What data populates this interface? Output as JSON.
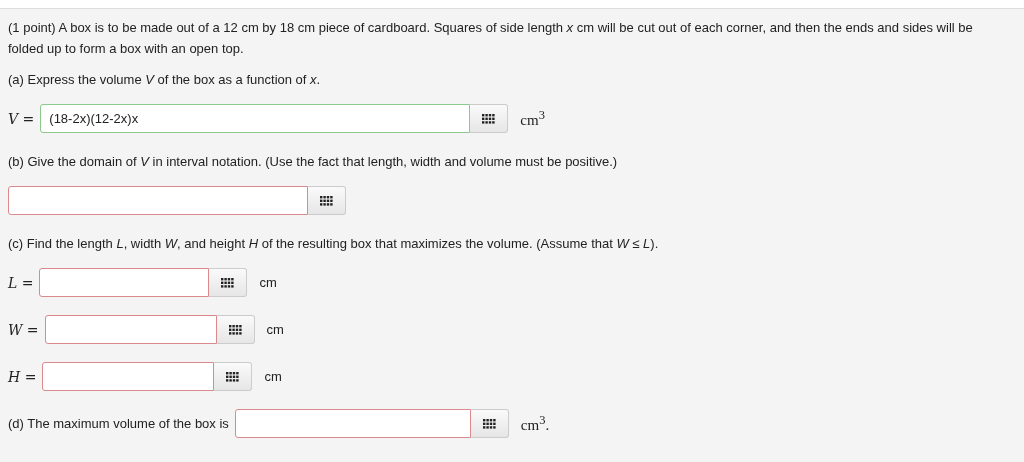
{
  "intro": "(1 point) A box is to be made out of a 12 cm by 18 cm piece of cardboard. Squares of side length *x* cm will be cut out of each corner, and then the ends and sides will be folded up to form a box with an open top.",
  "parts": [
    {
      "kind": "question",
      "text": "(a) Express the volume *V* of the box as a function of *x*."
    },
    {
      "kind": "answer",
      "label": "*V* =",
      "value": "(18-2x)(12-2x)x",
      "correct": true,
      "unit": "cm$^{3}$",
      "unit_math": true
    },
    {
      "kind": "question",
      "text": "(b) Give the domain of *V* in interval notation. (Use the fact that length, width and volume must be positive.)"
    },
    {
      "kind": "answer",
      "correct": false
    },
    {
      "kind": "question",
      "text": "(c) Find the length *L*, width *W*, and height *H* of the resulting box that maximizes the volume. (Assume that *W* ≤ *L*)."
    },
    {
      "kind": "answer",
      "label": "*L* =",
      "correct": false,
      "unit": "cm",
      "unit_math": false
    },
    {
      "kind": "answer",
      "label": "*W* =",
      "correct": false,
      "unit": "cm",
      "unit_math": false
    },
    {
      "kind": "answer",
      "label": "*H* =",
      "correct": false,
      "unit": "cm",
      "unit_math": false
    },
    {
      "kind": "answer",
      "prompt": "(d) The maximum volume of the box is",
      "correct": false,
      "unit": "cm$^{3}$.",
      "unit_math": true
    }
  ]
}
